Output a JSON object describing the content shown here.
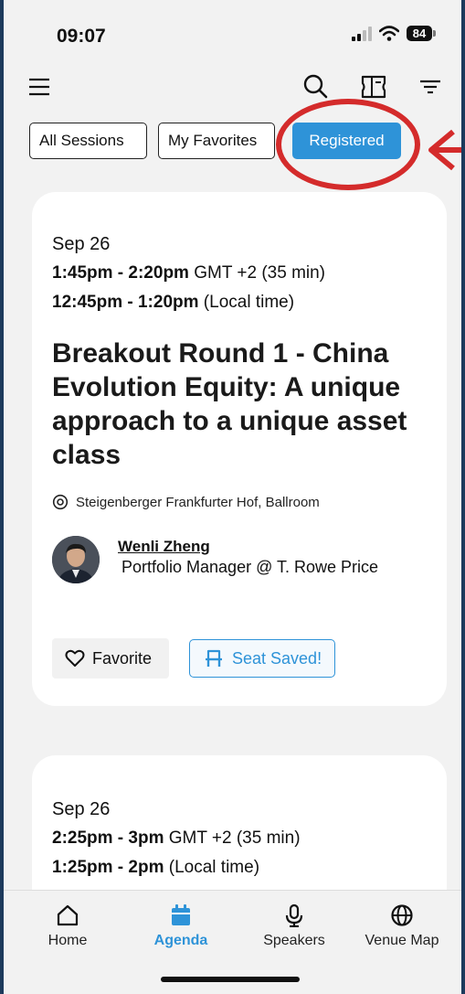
{
  "status_bar": {
    "time": "09:07",
    "battery": "84"
  },
  "tabs": [
    {
      "label": "All Sessions",
      "active": false
    },
    {
      "label": "My Favorites",
      "active": false
    },
    {
      "label": "Registered",
      "active": true
    }
  ],
  "sessions": [
    {
      "date": "Sep 26",
      "time_range": "1:45pm - 2:20pm",
      "timezone": "GMT +2",
      "duration": "(35 min)",
      "local_range": "12:45pm - 1:20pm",
      "local_label": "(Local time)",
      "title": "Breakout Round 1 - China Evolution Equity: A unique approach to a unique asset class",
      "location": "Steigenberger Frankfurter Hof, Ballroom",
      "speaker_name": "Wenli Zheng",
      "speaker_role": "Portfolio Manager @ T. Rowe Price",
      "favorite_label": "Favorite",
      "seat_label": "Seat Saved!"
    },
    {
      "date": "Sep 26",
      "time_range": "2:25pm - 3pm",
      "timezone": "GMT +2",
      "duration": "(35 min)",
      "local_range": "1:25pm - 2pm",
      "local_label": "(Local time)"
    }
  ],
  "nav": [
    {
      "label": "Home",
      "icon": "home-icon",
      "active": false
    },
    {
      "label": "Agenda",
      "icon": "calendar-icon",
      "active": true
    },
    {
      "label": "Speakers",
      "icon": "microphone-icon",
      "active": false
    },
    {
      "label": "Venue Map",
      "icon": "globe-icon",
      "active": false
    }
  ],
  "colors": {
    "accent": "#2e93d8",
    "annotation": "#d42b2b",
    "background": "#f2f2f2"
  }
}
